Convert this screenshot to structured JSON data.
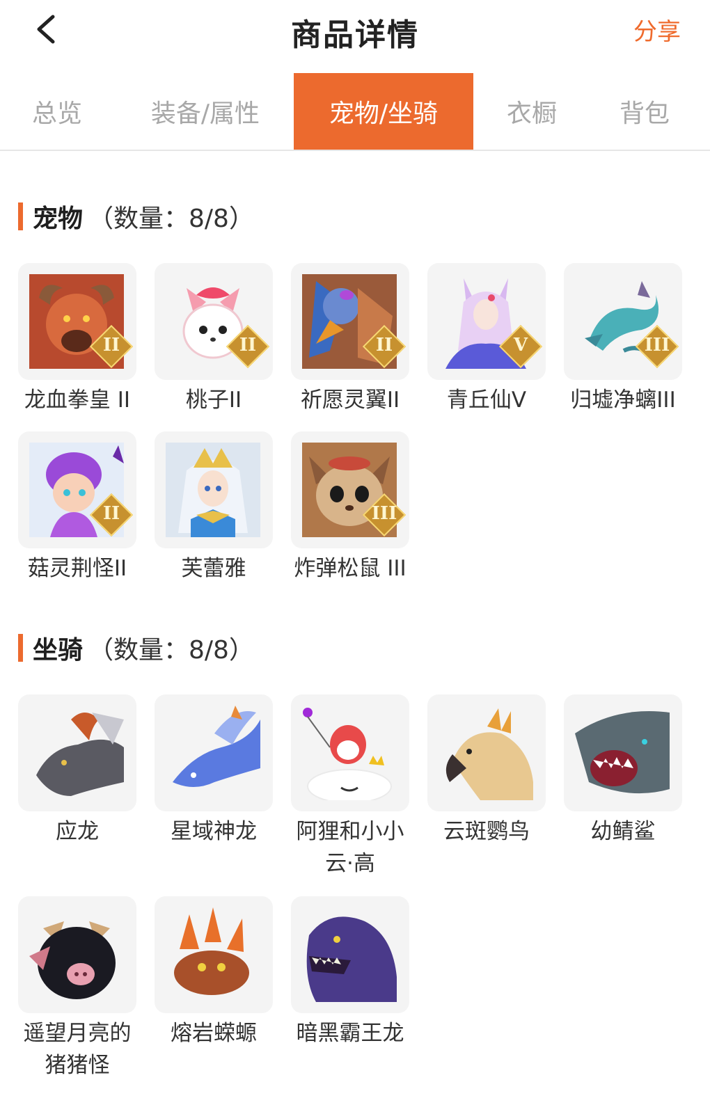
{
  "header": {
    "back_icon": "chevron-left-icon",
    "title": "商品详情",
    "share_label": "分享",
    "accent_color": "#ec6a2e"
  },
  "tabs": [
    {
      "label": "总览",
      "active": false
    },
    {
      "label": "装备/属性",
      "active": false
    },
    {
      "label": "宠物/坐骑",
      "active": true
    },
    {
      "label": "衣橱",
      "active": false
    },
    {
      "label": "背包",
      "active": false
    }
  ],
  "pets": {
    "name": "宠物",
    "count_text": "（数量：8/8）",
    "items": [
      {
        "name": "龙血拳皇 II",
        "badge": "II"
      },
      {
        "name": "桃子II",
        "badge": "II"
      },
      {
        "name": "祈愿灵翼II",
        "badge": "II"
      },
      {
        "name": "青丘仙V",
        "badge": "V"
      },
      {
        "name": "归墟净螭III",
        "badge": "III"
      },
      {
        "name": "菇灵荆怪II",
        "badge": "II"
      },
      {
        "name": "芙蕾雅",
        "badge": ""
      },
      {
        "name": "炸弹松鼠 III",
        "badge": "III"
      }
    ]
  },
  "mounts": {
    "name": "坐骑",
    "count_text": "（数量：8/8）",
    "items": [
      {
        "name": "应龙"
      },
      {
        "name": "星域神龙"
      },
      {
        "name": "阿狸和小小云·高"
      },
      {
        "name": "云斑鹦鸟"
      },
      {
        "name": "幼鲭鲨"
      },
      {
        "name": "遥望月亮的猪猪怪"
      },
      {
        "name": "熔岩蝾螈"
      },
      {
        "name": "暗黑霸王龙"
      }
    ]
  }
}
